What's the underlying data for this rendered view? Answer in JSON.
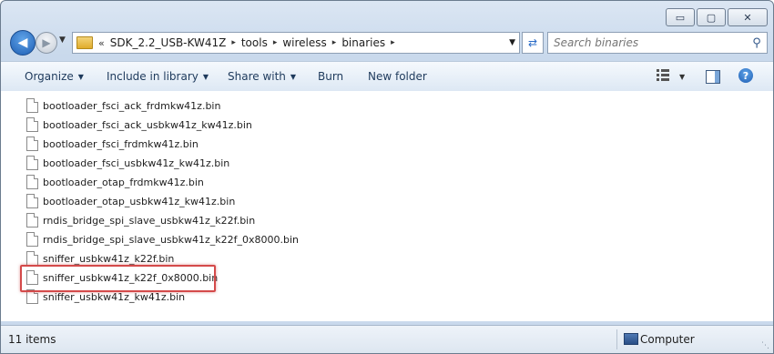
{
  "window": {
    "caption_buttons": {
      "minimize": "▭",
      "maximize": "▢",
      "close": "✕"
    }
  },
  "address": {
    "overflow": "«",
    "breadcrumbs": [
      "SDK_2.2_USB-KW41Z",
      "tools",
      "wireless",
      "binaries"
    ],
    "separator": "▸"
  },
  "search": {
    "placeholder": "Search binaries"
  },
  "toolbar": {
    "organize": "Organize",
    "include_in_library": "Include in library",
    "share_with": "Share with",
    "burn": "Burn",
    "new_folder": "New folder",
    "help": "?"
  },
  "files": [
    "bootloader_fsci_ack_frdmkw41z.bin",
    "bootloader_fsci_ack_usbkw41z_kw41z.bin",
    "bootloader_fsci_frdmkw41z.bin",
    "bootloader_fsci_usbkw41z_kw41z.bin",
    "bootloader_otap_frdmkw41z.bin",
    "bootloader_otap_usbkw41z_kw41z.bin",
    "rndis_bridge_spi_slave_usbkw41z_k22f.bin",
    "rndis_bridge_spi_slave_usbkw41z_k22f_0x8000.bin",
    "sniffer_usbkw41z_k22f.bin",
    "sniffer_usbkw41z_k22f_0x8000.bin",
    "sniffer_usbkw41z_kw41z.bin"
  ],
  "highlighted_file_index": 9,
  "status": {
    "item_count": "11 items",
    "location": "Computer"
  },
  "colors": {
    "highlight_border": "#d44a4a",
    "accent": "#1f5fb4"
  }
}
